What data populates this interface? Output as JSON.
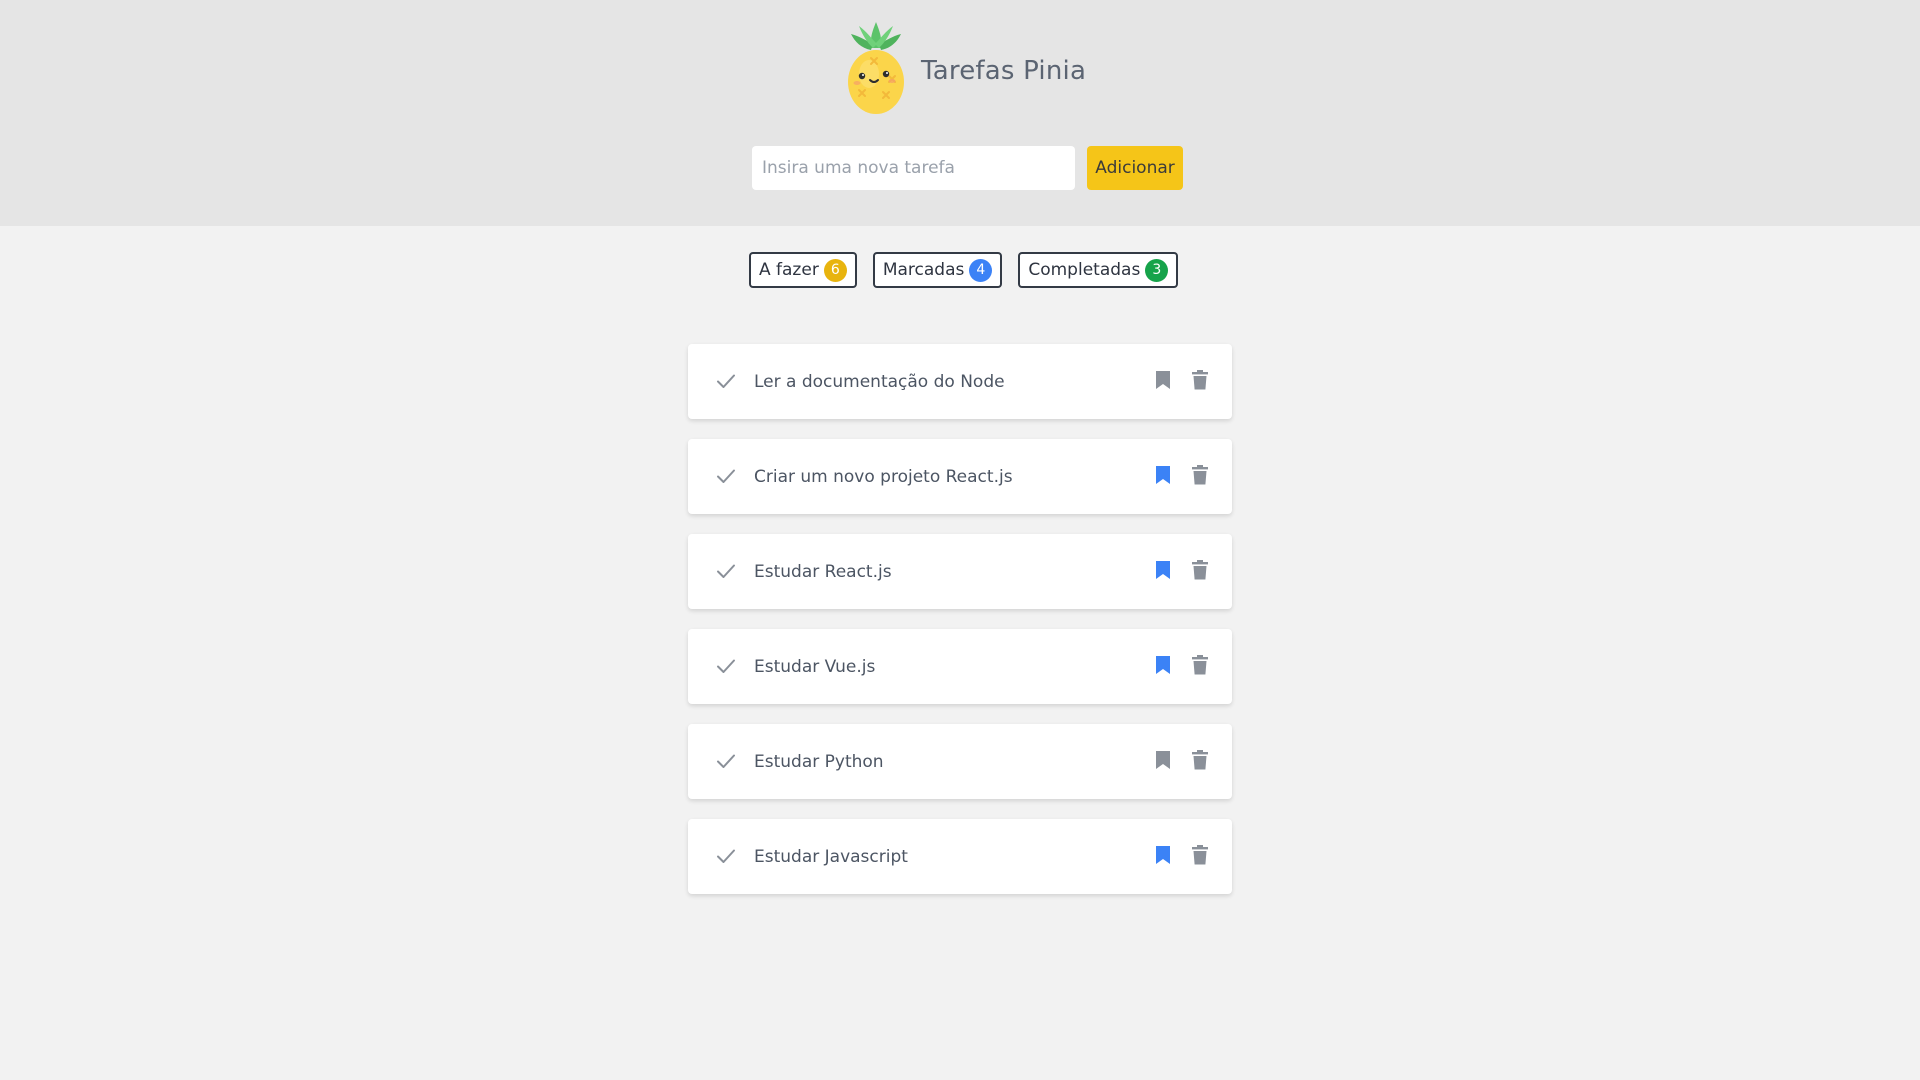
{
  "header": {
    "title": "Tarefas Pinia",
    "logo_icon": "pineapple-logo-icon",
    "input_placeholder": "Insira uma nova tarefa",
    "input_value": "",
    "add_label": "Adicionar"
  },
  "filters": [
    {
      "label": "A fazer",
      "count": "6",
      "color": "#e8b40e"
    },
    {
      "label": "Marcadas",
      "count": "4",
      "color": "#3b82f6"
    },
    {
      "label": "Completadas",
      "count": "3",
      "color": "#16a34a"
    }
  ],
  "tasks": [
    {
      "title": "Ler a documentação do Node",
      "bookmarked": false
    },
    {
      "title": "Criar um novo projeto React.js",
      "bookmarked": true
    },
    {
      "title": "Estudar React.js",
      "bookmarked": true
    },
    {
      "title": "Estudar Vue.js",
      "bookmarked": true
    },
    {
      "title": "Estudar Python",
      "bookmarked": false
    },
    {
      "title": "Estudar Javascript",
      "bookmarked": true
    }
  ],
  "colors": {
    "bookmark_active": "#3b82f6",
    "bookmark_inactive": "#8a9099",
    "check": "#8a9099",
    "trash": "#8a9099"
  }
}
